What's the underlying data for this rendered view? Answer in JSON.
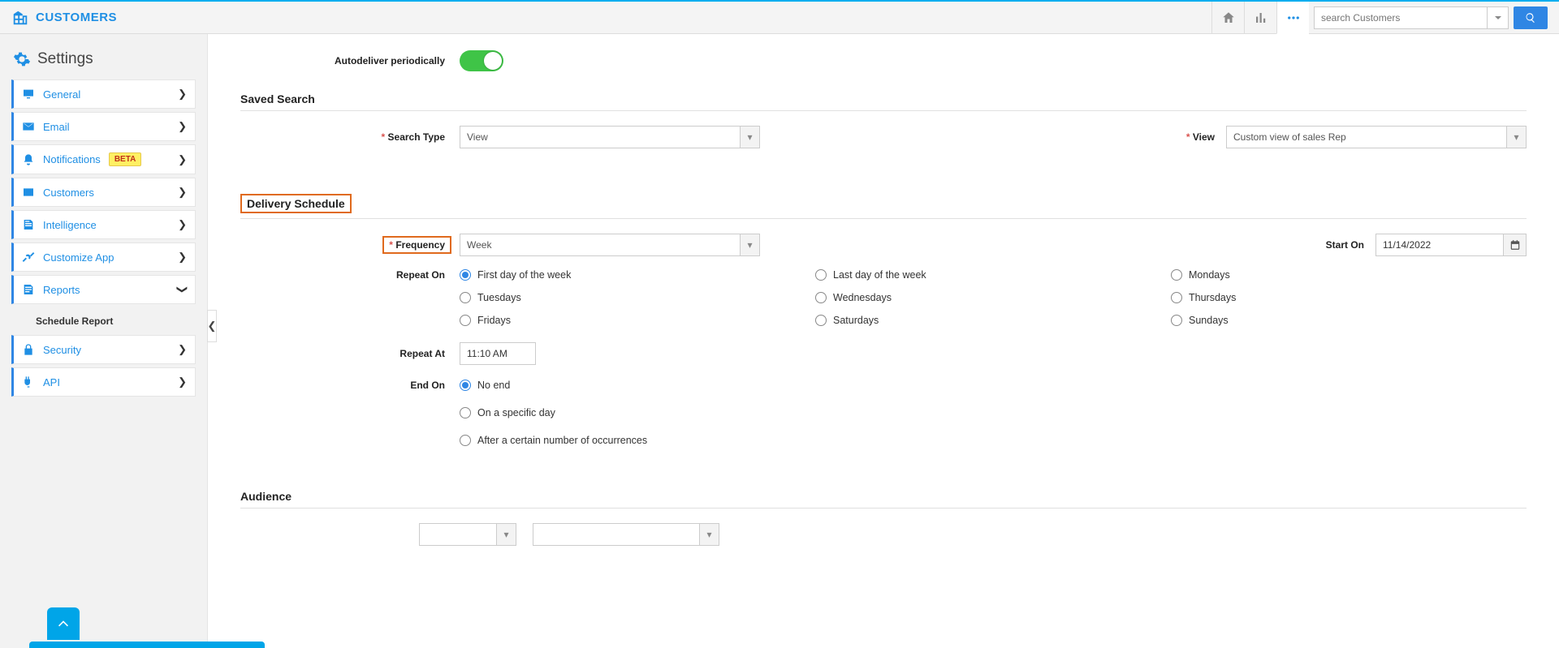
{
  "brand": "CUSTOMERS",
  "search": {
    "placeholder": "search Customers"
  },
  "sidebar": {
    "title": "Settings",
    "items": [
      {
        "label": "General"
      },
      {
        "label": "Email"
      },
      {
        "label": "Notifications",
        "beta": "BETA"
      },
      {
        "label": "Customers"
      },
      {
        "label": "Intelligence"
      },
      {
        "label": "Customize App"
      },
      {
        "label": "Reports"
      }
    ],
    "subitem": "Schedule Report",
    "footer": [
      {
        "label": "Security"
      },
      {
        "label": "API"
      }
    ]
  },
  "form": {
    "autodeliver_label": "Autodeliver periodically",
    "saved_search_title": "Saved Search",
    "search_type_label": "Search Type",
    "search_type_value": "View",
    "view_label": "View",
    "view_value": "Custom view of sales Rep",
    "delivery_title": "Delivery Schedule",
    "frequency_label": "Frequency",
    "frequency_value": "Week",
    "start_on_label": "Start On",
    "start_on_value": "11/14/2022",
    "repeat_on_label": "Repeat On",
    "repeat_options": {
      "r1c1": "First day of the week",
      "r1c2": "Last day of the week",
      "r1c3": "Mondays",
      "r2c1": "Tuesdays",
      "r2c2": "Wednesdays",
      "r2c3": "Thursdays",
      "r3c1": "Fridays",
      "r3c2": "Saturdays",
      "r3c3": "Sundays"
    },
    "repeat_at_label": "Repeat At",
    "repeat_at_value": "11:10 AM",
    "end_on_label": "End On",
    "end_opts": {
      "o1": "No end",
      "o2": "On a specific day",
      "o3": "After a certain number of occurrences"
    },
    "audience_title": "Audience"
  }
}
